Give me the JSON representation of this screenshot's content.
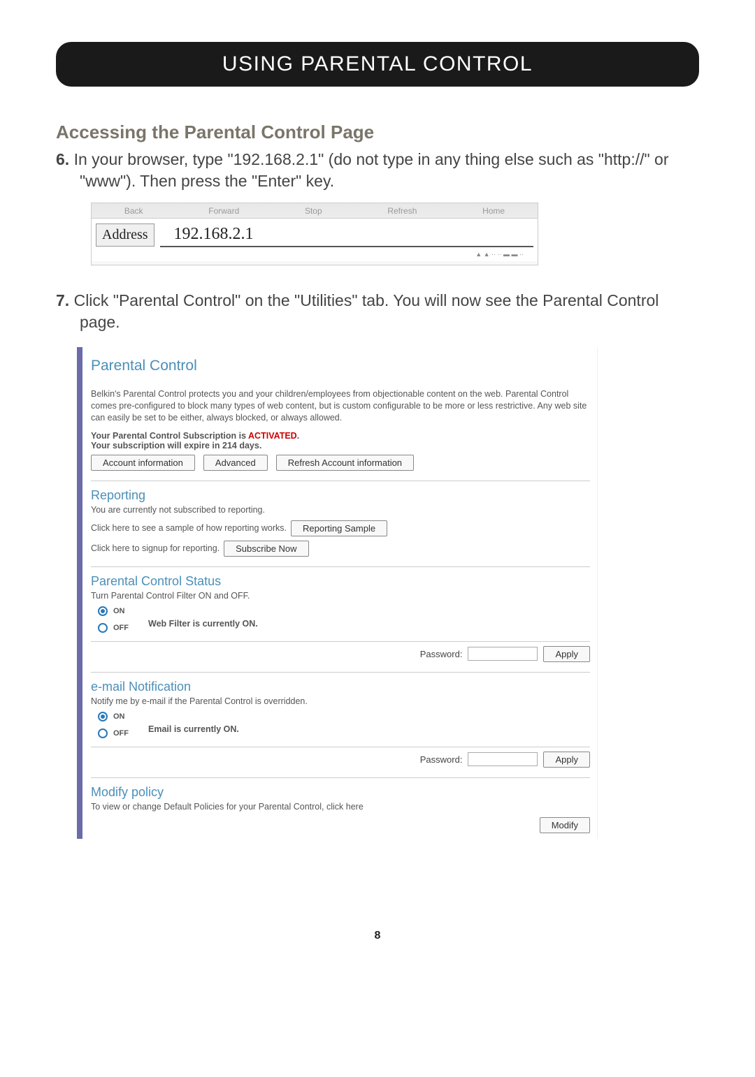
{
  "title": "USING PARENTAL CONTROL",
  "heading": "Accessing the Parental Control Page",
  "step6_num": "6.",
  "step6_text": "In your browser, type \"192.168.2.1\" (do not type in any thing else such as \"http://\" or \"www\"). Then press the \"Enter\" key.",
  "toolbar": [
    "Back",
    "Forward",
    "Stop",
    "Refresh",
    "Home"
  ],
  "address_label": "Address",
  "address_value": "192.168.2.1",
  "step7_num": "7.",
  "step7_text": "Click \"Parental Control\" on the \"Utilities\" tab. You will now see the Parental Control page.",
  "panel": {
    "title": "Parental Control",
    "description": "Belkin's Parental Control protects you and your children/employees from objectionable content on the web. Parental Control comes pre-configured to block many types of web content, but is custom configurable to be more or less restrictive. Any web site can easily be set to be either, always blocked, or always allowed.",
    "status_line1_a": "Your Parental Control Subscription is ",
    "status_line1_b": "ACTIVATED",
    "status_line1_c": ".",
    "status_line2": "Your subscription will expire in 214 days.",
    "btn_account": "Account information",
    "btn_advanced": "Advanced",
    "btn_refresh": "Refresh Account information",
    "reporting": {
      "title": "Reporting",
      "sub": "You are currently not subscribed to reporting.",
      "sample_text": "Click here to see a sample of how reporting works.",
      "sample_btn": "Reporting Sample",
      "signup_text": "Click here to signup for reporting.",
      "signup_btn": "Subscribe Now"
    },
    "status": {
      "title": "Parental Control Status",
      "sub": "Turn Parental Control Filter ON and OFF.",
      "on": "ON",
      "off": "OFF",
      "text": "Web Filter is currently ON.",
      "pw_label": "Password:",
      "apply": "Apply"
    },
    "email": {
      "title": "e-mail Notification",
      "sub": "Notify me by e-mail if the Parental Control is overridden.",
      "on": "ON",
      "off": "OFF",
      "text": "Email is currently ON.",
      "pw_label": "Password:",
      "apply": "Apply"
    },
    "modify": {
      "title": "Modify policy",
      "sub": "To view or change Default Policies for your Parental Control, click here",
      "btn": "Modify"
    }
  },
  "page_number": "8"
}
